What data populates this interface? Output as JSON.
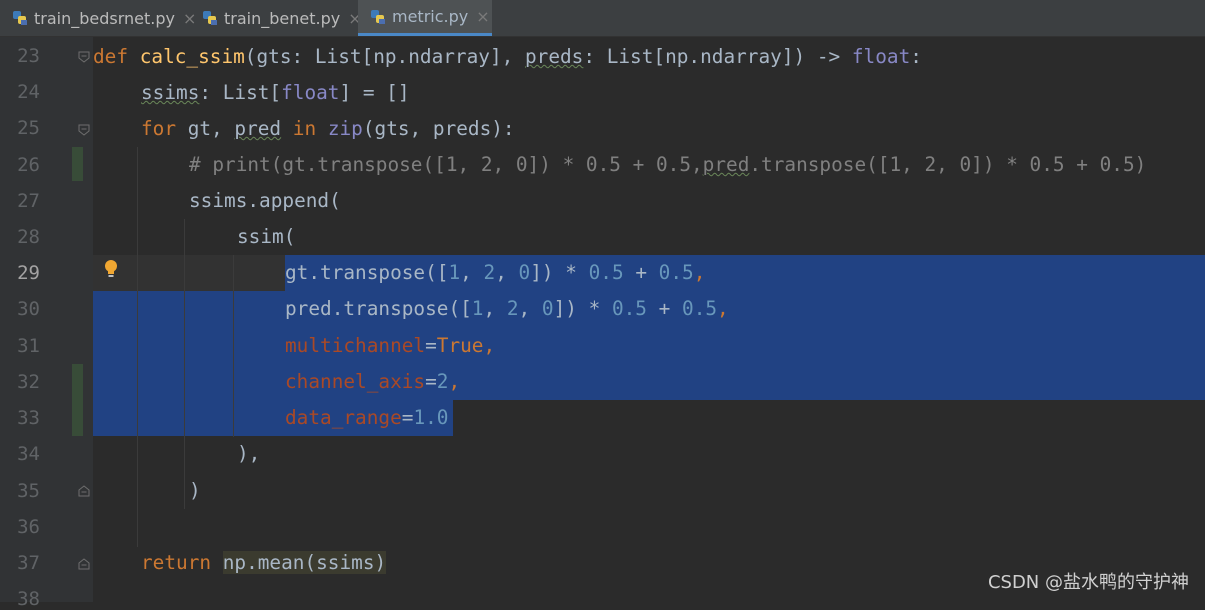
{
  "tabs": [
    {
      "label": "train_bedsrnet.py",
      "active": false
    },
    {
      "label": "train_benet.py",
      "active": false
    },
    {
      "label": "metric.py",
      "active": true
    }
  ],
  "close_glyph": "×",
  "line_numbers": [
    "23",
    "24",
    "25",
    "26",
    "27",
    "28",
    "29",
    "30",
    "31",
    "32",
    "33",
    "34",
    "35",
    "36",
    "37",
    "38"
  ],
  "current_line": "29",
  "code": {
    "l23": {
      "def": "def",
      "name": "calc_ssim",
      "open": "(gts: List[np.ndarray], ",
      "preds": "preds",
      "rest": ": List[np.ndarray]) -> ",
      "float": "float",
      "colon": ":"
    },
    "l24": {
      "ssims": "ssims",
      "mid": ": List[",
      "float": "float",
      "end": "] = []"
    },
    "l25": {
      "for": "for",
      "a": " gt, ",
      "pred": "pred",
      "in": " in ",
      "zip": "zip",
      "b": "(gts, preds):"
    },
    "l26": {
      "c1": "# print(gt.transpose([1, 2, 0]) * 0.5 + 0.5,",
      "pred": "pred",
      "c2": ".transpose([1, 2, 0]) * 0.5 + 0.5)"
    },
    "l27": {
      "text": "ssims.append("
    },
    "l28": {
      "text": "ssim("
    },
    "l29": {
      "a": "gt.transpose([",
      "n1": "1",
      "c1": ", ",
      "n2": "2",
      "c2": ", ",
      "n3": "0",
      "b": "]) * ",
      "n4": "0.5",
      "c": " + ",
      "n5": "0.5",
      "d": ","
    },
    "l30": {
      "a": "pred.transpose([",
      "n1": "1",
      "c1": ", ",
      "n2": "2",
      "c2": ", ",
      "n3": "0",
      "b": "]) * ",
      "n4": "0.5",
      "c": " + ",
      "n5": "0.5",
      "d": ","
    },
    "l31": {
      "param": "multichannel",
      "eq": "=",
      "val": "True",
      "comma": ","
    },
    "l32": {
      "param": "channel_axis",
      "eq": "=",
      "val": "2",
      "comma": ","
    },
    "l33": {
      "param": "data_range",
      "eq": "=",
      "val": "1.0"
    },
    "l34": {
      "text": "),"
    },
    "l35": {
      "text": ")"
    },
    "l37": {
      "ret": "return",
      "sp": " ",
      "expr": "np.mean(ssims)"
    }
  },
  "watermark": "CSDN @盐水鸭的守护神",
  "colors": {
    "selection": "#214283",
    "keyword": "#cc7832",
    "function": "#ffc66d",
    "number": "#6897bb",
    "parameter": "#aa4926",
    "comment": "#808080"
  },
  "icons": {
    "tab_file": "python-file-icon",
    "gutter_hint": "lightbulb-icon",
    "fold": "fold-marker-icon"
  }
}
